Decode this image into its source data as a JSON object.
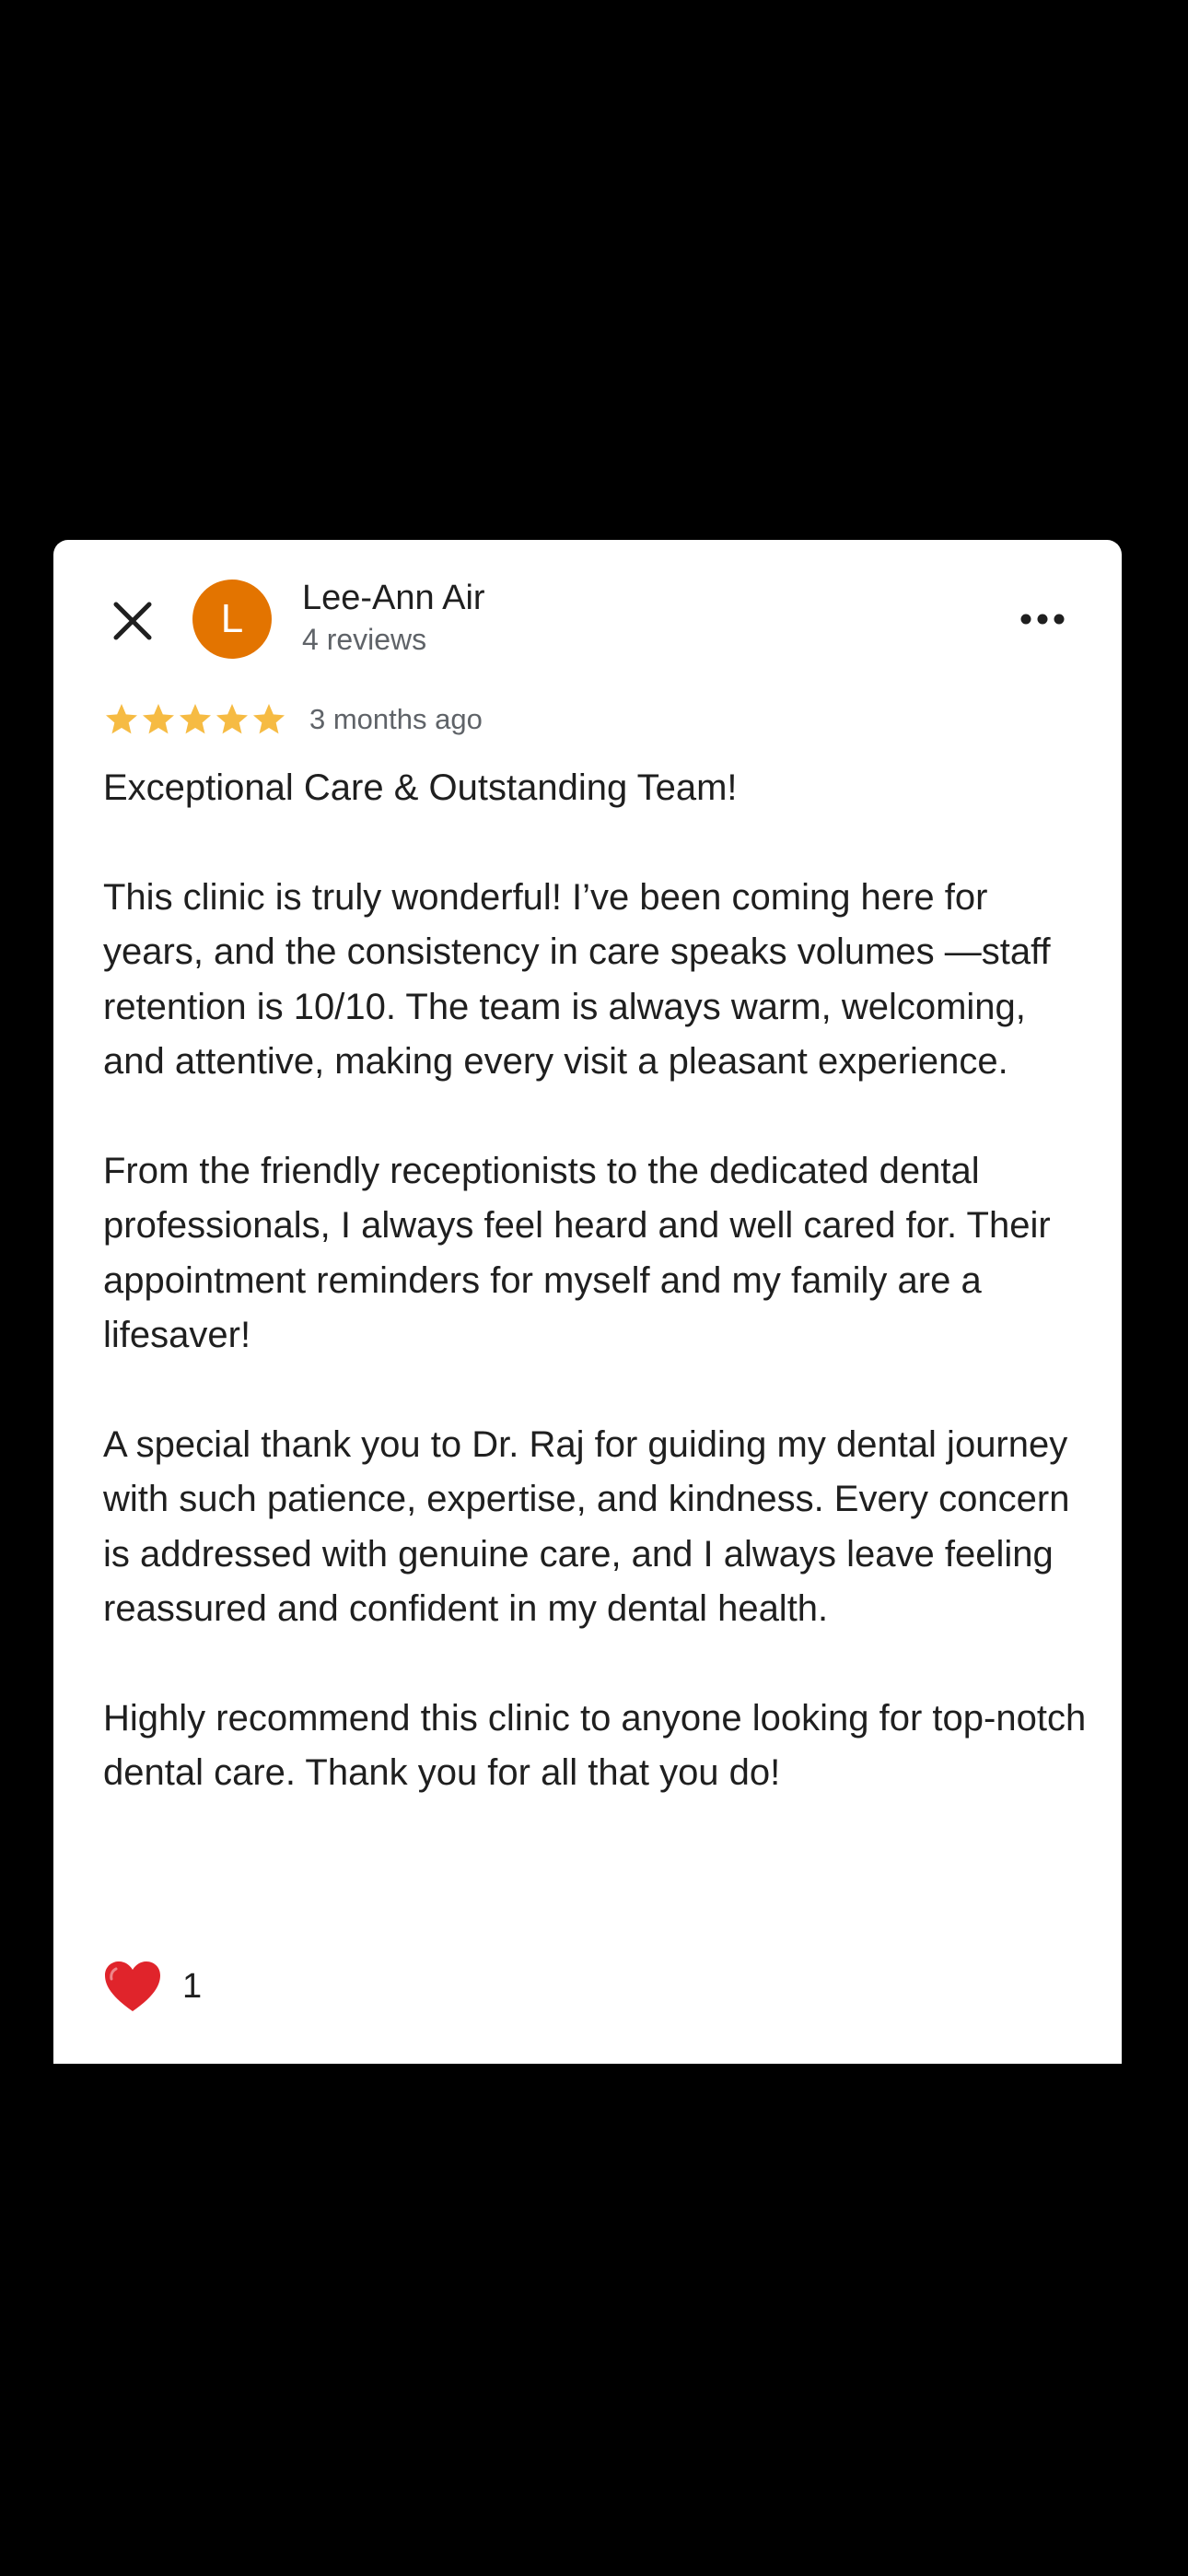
{
  "author": {
    "name": "Lee-Ann Air",
    "initial": "L",
    "review_count": "4 reviews",
    "avatar_color": "#E37400"
  },
  "review": {
    "rating": 5,
    "rating_max": 5,
    "time_ago": "3 months ago",
    "title": "Exceptional Care & Outstanding Team!",
    "paragraphs": [
      "This clinic is truly wonderful! I’ve been coming here for years, and the consistency in care speaks volumes —staff retention is 10/10. The team is always warm, welcoming, and attentive, making every visit a pleasant experience.",
      "From the friendly receptionists to the dedicated dental professionals, I always feel heard and well cared for. Their appointment reminders for myself and my family are a lifesaver!",
      "A special thank you to Dr. Raj for guiding my dental journey with such patience, expertise, and kindness. Every concern is addressed with genuine care, and I always leave feeling reassured and confident in my dental health.",
      "Highly recommend this clinic to anyone looking for top-notch dental care. Thank you for all that you do!"
    ]
  },
  "reactions": {
    "heart_count": "1"
  },
  "icons": {
    "close": "close-icon",
    "more": "more-horizontal-icon",
    "star": "star-icon",
    "heart": "heart-icon"
  },
  "colors": {
    "star": "#F6BB43",
    "heart": "#E0242B",
    "background": "#000000",
    "card": "#FFFFFF"
  }
}
